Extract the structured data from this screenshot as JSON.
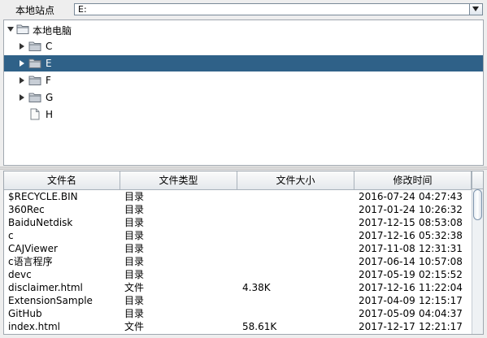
{
  "topbar": {
    "site_label": "本地站点",
    "path_value": "E:"
  },
  "tree": {
    "root": {
      "label": "本地电脑",
      "icon": "folder-open-icon"
    },
    "items": [
      {
        "label": "C",
        "icon": "folder-icon",
        "has_children": true,
        "selected": false
      },
      {
        "label": "E",
        "icon": "folder-icon",
        "has_children": true,
        "selected": true
      },
      {
        "label": "F",
        "icon": "folder-icon",
        "has_children": true,
        "selected": false
      },
      {
        "label": "G",
        "icon": "folder-icon",
        "has_children": true,
        "selected": false
      },
      {
        "label": "H",
        "icon": "file-icon",
        "has_children": false,
        "selected": false
      }
    ]
  },
  "table": {
    "columns": [
      "文件名",
      "文件类型",
      "文件大小",
      "修改时间"
    ],
    "rows": [
      {
        "name": "$RECYCLE.BIN",
        "type": "目录",
        "size": "",
        "date": "2016-07-24",
        "time": "04:27:43"
      },
      {
        "name": "360Rec",
        "type": "目录",
        "size": "",
        "date": "2017-01-24",
        "time": "10:26:32"
      },
      {
        "name": "BaiduNetdisk",
        "type": "目录",
        "size": "",
        "date": "2017-12-15",
        "time": "08:53:08"
      },
      {
        "name": "c",
        "type": "目录",
        "size": "",
        "date": "2017-12-16",
        "time": "05:32:38"
      },
      {
        "name": "CAJViewer",
        "type": "目录",
        "size": "",
        "date": "2017-11-08",
        "time": "12:31:31"
      },
      {
        "name": "c语言程序",
        "type": "目录",
        "size": "",
        "date": "2017-06-14",
        "time": "10:57:08"
      },
      {
        "name": "devc",
        "type": "目录",
        "size": "",
        "date": "2017-05-19",
        "time": "02:15:52"
      },
      {
        "name": "disclaimer.html",
        "type": "文件",
        "size": "4.38K",
        "date": "2017-12-16",
        "time": "11:22:04"
      },
      {
        "name": "ExtensionSample",
        "type": "目录",
        "size": "",
        "date": "2017-04-09",
        "time": "12:15:17"
      },
      {
        "name": "GitHub",
        "type": "目录",
        "size": "",
        "date": "2017-05-09",
        "time": "04:04:37"
      },
      {
        "name": "index.html",
        "type": "文件",
        "size": "58.61K",
        "date": "2017-12-17",
        "time": "12:21:17"
      }
    ]
  },
  "colors": {
    "selection": "#2f6188",
    "background": "#eeeeee"
  }
}
